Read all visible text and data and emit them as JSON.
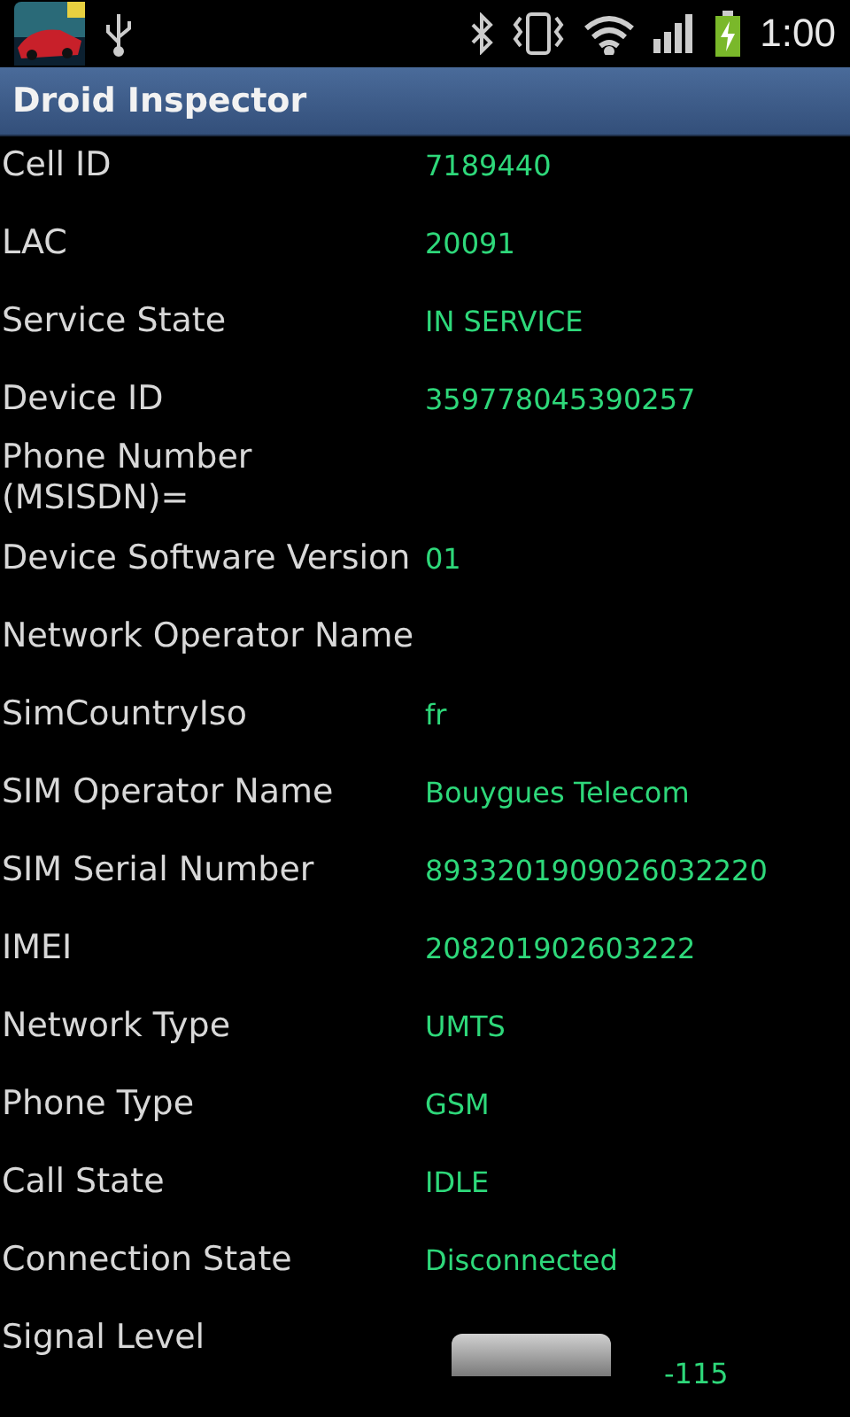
{
  "status_bar": {
    "time": "1:00"
  },
  "title": "Droid Inspector",
  "rows": [
    {
      "kind": "text",
      "label": "Cell ID",
      "value": "7189440"
    },
    {
      "kind": "text",
      "label": "LAC",
      "value": "20091"
    },
    {
      "kind": "text",
      "label": "Service State",
      "value": "IN SERVICE"
    },
    {
      "kind": "text",
      "label": "Device ID",
      "value": "359778045390257"
    },
    {
      "kind": "text",
      "label": "Phone Number (MSISDN)="
    },
    {
      "kind": "text",
      "label": "Device Software Version",
      "value": "01"
    },
    {
      "kind": "text",
      "label": "Network Operator Name"
    },
    {
      "kind": "text",
      "label": "SimCountryIso",
      "value": "fr"
    },
    {
      "kind": "text",
      "label": "SIM Operator Name",
      "value": "Bouygues Telecom"
    },
    {
      "kind": "text",
      "label": "SIM Serial Number",
      "value": "8933201909026032220"
    },
    {
      "kind": "text",
      "label": "IMEI",
      "value": "208201902603222"
    },
    {
      "kind": "text",
      "label": "Network Type",
      "value": "UMTS"
    },
    {
      "kind": "text",
      "label": "Phone Type",
      "value": "GSM"
    },
    {
      "kind": "text",
      "label": "Call State",
      "value": "IDLE"
    },
    {
      "kind": "text",
      "label": "Connection State",
      "value": "Disconnected"
    },
    {
      "kind": "signal",
      "label": "Signal Level",
      "value": "-115"
    }
  ]
}
